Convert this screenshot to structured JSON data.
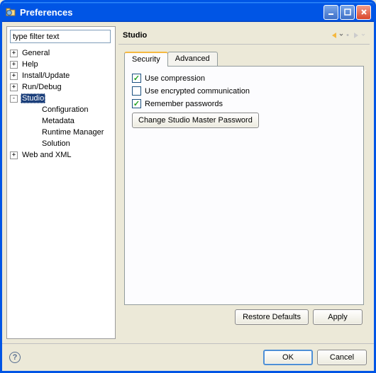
{
  "window": {
    "title": "Preferences"
  },
  "filter": {
    "placeholder": "type filter text"
  },
  "tree": {
    "items": [
      {
        "label": "General"
      },
      {
        "label": "Help"
      },
      {
        "label": "Install/Update"
      },
      {
        "label": "Run/Debug"
      },
      {
        "label": "Studio",
        "children": [
          {
            "label": "Configuration"
          },
          {
            "label": "Metadata"
          },
          {
            "label": "Runtime Manager"
          },
          {
            "label": "Solution"
          }
        ]
      },
      {
        "label": "Web and XML"
      }
    ]
  },
  "page": {
    "title": "Studio",
    "tabs": [
      {
        "label": "Security"
      },
      {
        "label": "Advanced"
      }
    ],
    "checks": {
      "compression": "Use compression",
      "encrypted": "Use encrypted communication",
      "remember": "Remember passwords"
    },
    "change_pwd_btn": "Change Studio Master Password"
  },
  "buttons": {
    "restore": "Restore Defaults",
    "apply": "Apply",
    "ok": "OK",
    "cancel": "Cancel"
  }
}
